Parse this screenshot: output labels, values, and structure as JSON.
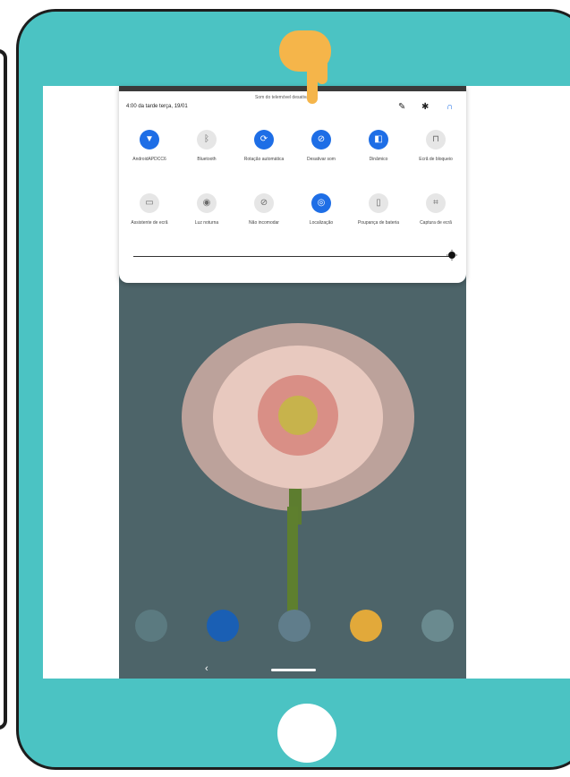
{
  "panel": {
    "datetime": "4:00 da tarde  terça, 19/01",
    "notice": "Som do telemóvel desativado"
  },
  "header_icons": [
    {
      "name": "edit-icon",
      "glyph": "✎"
    },
    {
      "name": "settings-icon",
      "glyph": "✱"
    },
    {
      "name": "account-icon",
      "glyph": "∩"
    }
  ],
  "tiles_row1": [
    {
      "label": "AndroidAPDCC6",
      "icon": "wifi-icon",
      "glyph": "▼",
      "on": true
    },
    {
      "label": "Bluetooth",
      "icon": "bluetooth-icon",
      "glyph": "ᛒ",
      "on": false
    },
    {
      "label": "Rotação automática",
      "icon": "rotate-icon",
      "glyph": "⟳",
      "on": true
    },
    {
      "label": "Desativar som",
      "icon": "bell-off-icon",
      "glyph": "⊘",
      "on": true
    },
    {
      "label": "Dinâmico",
      "icon": "display-mode-icon",
      "glyph": "◧",
      "on": true
    },
    {
      "label": "Ecrã de bloqueio",
      "icon": "lock-icon",
      "glyph": "⊓",
      "on": false
    }
  ],
  "tiles_row2": [
    {
      "label": "Assistente de ecrã",
      "icon": "screen-assistant-icon",
      "glyph": "▭",
      "on": false
    },
    {
      "label": "Luz noturna",
      "icon": "eye-icon",
      "glyph": "◉",
      "on": false
    },
    {
      "label": "Não incomodar",
      "icon": "do-not-disturb-icon",
      "glyph": "⊘",
      "on": false
    },
    {
      "label": "Localização",
      "icon": "location-icon",
      "glyph": "◎",
      "on": true
    },
    {
      "label": "Poupança de bateria",
      "icon": "battery-icon",
      "glyph": "▯",
      "on": false
    },
    {
      "label": "Captura de ecrã",
      "icon": "crop-icon",
      "glyph": "⌗",
      "on": false
    }
  ],
  "brightness_slider": {
    "level": 1.0
  },
  "dock_apps": [
    {
      "name": "google-apps-folder-icon",
      "color": "#5b7a80"
    },
    {
      "name": "outlook-icon",
      "color": "#1a5fb4"
    },
    {
      "name": "settings-app-icon",
      "color": "#607d8b"
    },
    {
      "name": "chrome-icon",
      "color": "#e2a93a"
    },
    {
      "name": "play-store-icon",
      "color": "#6a8a8f"
    }
  ],
  "nav": {
    "back": "‹"
  },
  "colors": {
    "frame": "#4bc3c3",
    "accent": "#1e6ee6",
    "hand": "#f5b54a"
  }
}
